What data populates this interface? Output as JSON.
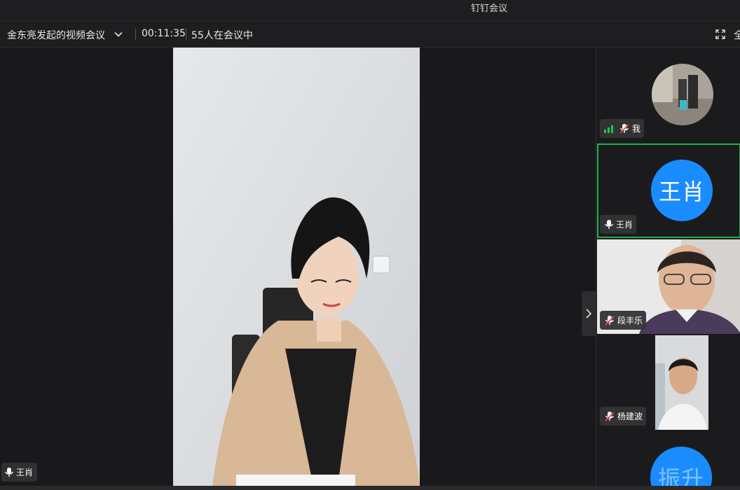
{
  "window": {
    "title": "钉钉会议"
  },
  "toolbar": {
    "meeting_title": "金东亮发起的视频会议",
    "elapsed": "00:11:35",
    "participants": "55人在会议中",
    "fullscreen_label": "全"
  },
  "main": {
    "speaker_name": "王肖"
  },
  "sidebar": {
    "tiles": [
      {
        "name": "我",
        "mic": "muted",
        "signal": "good",
        "type": "photo-avatar"
      },
      {
        "name": "王肖",
        "mic": "on",
        "type": "initials",
        "initials": "王肖",
        "active": true
      },
      {
        "name": "段丰乐",
        "mic": "muted",
        "type": "video"
      },
      {
        "name": "杨建波",
        "mic": "muted",
        "type": "video"
      },
      {
        "name": "",
        "type": "initials",
        "initials": "振升"
      }
    ]
  },
  "colors": {
    "accent": "#1a8cff",
    "active_border": "#1fb24a",
    "muted": "#e54a3a",
    "signal": "#25c24b"
  },
  "icons": [
    "chevron-down-icon",
    "fullscreen-icon",
    "microphone-icon",
    "microphone-muted-icon",
    "signal-icon",
    "chevron-right-icon"
  ]
}
